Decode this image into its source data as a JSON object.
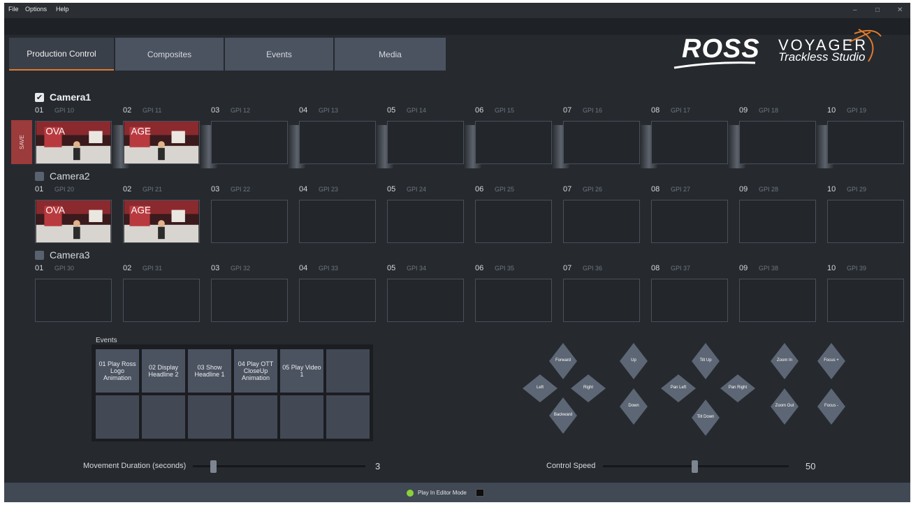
{
  "menu": {
    "file": "File",
    "options": "Options",
    "help": "Help"
  },
  "window_controls": {
    "minimize": "–",
    "maximize": "□",
    "close": "✕"
  },
  "tabs": [
    {
      "label": "Production Control"
    },
    {
      "label": "Composites"
    },
    {
      "label": "Events"
    },
    {
      "label": "Media"
    }
  ],
  "logo": {
    "ross": "ROSS",
    "voyager": "VOYAGER",
    "trackless": "Trackless Studio"
  },
  "save_label": "SAVE",
  "cameras": [
    {
      "label": "Camera1",
      "checked": true,
      "slots": [
        {
          "num": "01",
          "gpi": "GPI 10"
        },
        {
          "num": "02",
          "gpi": "GPI 11"
        },
        {
          "num": "03",
          "gpi": "GPI 12"
        },
        {
          "num": "04",
          "gpi": "GPI 13"
        },
        {
          "num": "05",
          "gpi": "GPI 14"
        },
        {
          "num": "06",
          "gpi": "GPI 15"
        },
        {
          "num": "07",
          "gpi": "GPI 16"
        },
        {
          "num": "08",
          "gpi": "GPI 17"
        },
        {
          "num": "09",
          "gpi": "GPI 18"
        },
        {
          "num": "10",
          "gpi": "GPI 19"
        }
      ]
    },
    {
      "label": "Camera2",
      "checked": false,
      "slots": [
        {
          "num": "01",
          "gpi": "GPI 20"
        },
        {
          "num": "02",
          "gpi": "GPI 21"
        },
        {
          "num": "03",
          "gpi": "GPI 22"
        },
        {
          "num": "04",
          "gpi": "GPI 23"
        },
        {
          "num": "05",
          "gpi": "GPI 24"
        },
        {
          "num": "06",
          "gpi": "GPI 25"
        },
        {
          "num": "07",
          "gpi": "GPI 26"
        },
        {
          "num": "08",
          "gpi": "GPI 27"
        },
        {
          "num": "09",
          "gpi": "GPI 28"
        },
        {
          "num": "10",
          "gpi": "GPI 29"
        }
      ]
    },
    {
      "label": "Camera3",
      "checked": false,
      "slots": [
        {
          "num": "01",
          "gpi": "GPI 30"
        },
        {
          "num": "02",
          "gpi": "GPI 31"
        },
        {
          "num": "03",
          "gpi": "GPI 32"
        },
        {
          "num": "04",
          "gpi": "GPI 33"
        },
        {
          "num": "05",
          "gpi": "GPI 34"
        },
        {
          "num": "06",
          "gpi": "GPI 35"
        },
        {
          "num": "07",
          "gpi": "GPI 36"
        },
        {
          "num": "08",
          "gpi": "GPI 37"
        },
        {
          "num": "09",
          "gpi": "GPI 38"
        },
        {
          "num": "10",
          "gpi": "GPI 39"
        }
      ]
    }
  ],
  "events": {
    "title": "Events",
    "buttons": [
      "01 Play Ross Logo Animation",
      "02 Display Headline 2",
      "03 Show Headline 1",
      "04 Play OTT CloseUp Animation",
      "05 Play Video 1",
      "",
      "",
      "",
      "",
      "",
      "",
      ""
    ]
  },
  "controls": {
    "forward": "Forward",
    "backward": "Backward",
    "left": "Left",
    "right": "Right",
    "up": "Up",
    "down": "Down",
    "tilt_up": "Tilt Up",
    "tilt_down": "Tilt Down",
    "pan_left": "Pan Left",
    "pan_right": "Pan Right",
    "zoom_in": "Zoom In",
    "zoom_out": "Zoom Out",
    "focus_plus": "Focus +",
    "focus_minus": "Focus -"
  },
  "movement_duration": {
    "label": "Movement Duration (seconds)",
    "value": "3"
  },
  "control_speed": {
    "label": "Control Speed",
    "value": "50"
  },
  "status": {
    "text": "Play In Editor Mode"
  },
  "colors": {
    "accent": "#e07a2d",
    "tab": "#4b5361",
    "save": "#9b3b3b",
    "status_ok": "#8cd13a"
  }
}
